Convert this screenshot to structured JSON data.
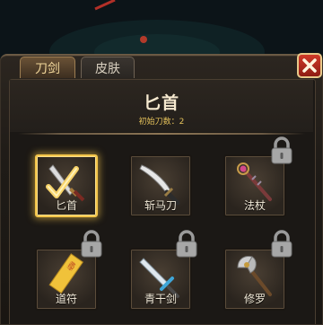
{
  "tabs": [
    {
      "label": "刀剑",
      "active": true
    },
    {
      "label": "皮肤",
      "active": false
    }
  ],
  "close_icon": "close-icon",
  "detail": {
    "title": "匕首",
    "subtitle": "初始刀数：2"
  },
  "items": [
    {
      "name": "匕首",
      "icon": "dagger-icon",
      "selected": true,
      "locked": false
    },
    {
      "name": "斩马刀",
      "icon": "machete-icon",
      "selected": false,
      "locked": false
    },
    {
      "name": "法杖",
      "icon": "staff-icon",
      "selected": false,
      "locked": true
    },
    {
      "name": "道符",
      "icon": "talisman-icon",
      "selected": false,
      "locked": true
    },
    {
      "name": "青干剑",
      "icon": "sword-icon",
      "selected": false,
      "locked": true
    },
    {
      "name": "修罗",
      "icon": "axe-icon",
      "selected": false,
      "locked": true
    }
  ],
  "talisman_text": "急急如律令",
  "colors": {
    "accent_gold": "#f3c54a",
    "close_red": "#c8321f",
    "panel_brown": "#2c2620"
  }
}
